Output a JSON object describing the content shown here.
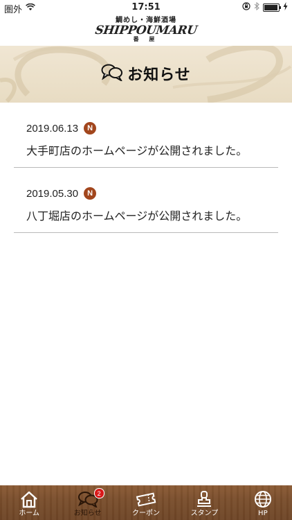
{
  "status_bar": {
    "carrier": "圏外",
    "time": "17:51"
  },
  "header": {
    "logo_top": "鯛めし・海鮮酒場",
    "logo_main": "SHIPPOUMARU",
    "logo_sub": "番 屋",
    "logo_icon": "shop-logo"
  },
  "banner": {
    "title": "お知らせ",
    "icon": "chat-bubbles-icon"
  },
  "news": [
    {
      "date": "2019.06.13",
      "badge": "N",
      "text": "大手町店のホームページが公開されました。"
    },
    {
      "date": "2019.05.30",
      "badge": "N",
      "text": "八丁堀店のホームページが公開されました。"
    }
  ],
  "tab_bar": {
    "tabs": [
      {
        "label": "ホーム",
        "icon": "home-icon"
      },
      {
        "label": "お知らせ",
        "icon": "chat-bubbles-icon",
        "badge": "2",
        "active": true
      },
      {
        "label": "クーポン",
        "icon": "coupon-icon"
      },
      {
        "label": "スタンプ",
        "icon": "stamp-icon"
      },
      {
        "label": "HP",
        "icon": "globe-icon"
      }
    ]
  },
  "colors": {
    "badge_brown": "#a2461d",
    "tab_bar_wood": "#7a4e2c",
    "banner_bg": "#ece1cb",
    "tab_badge_red": "#d91a1a"
  }
}
